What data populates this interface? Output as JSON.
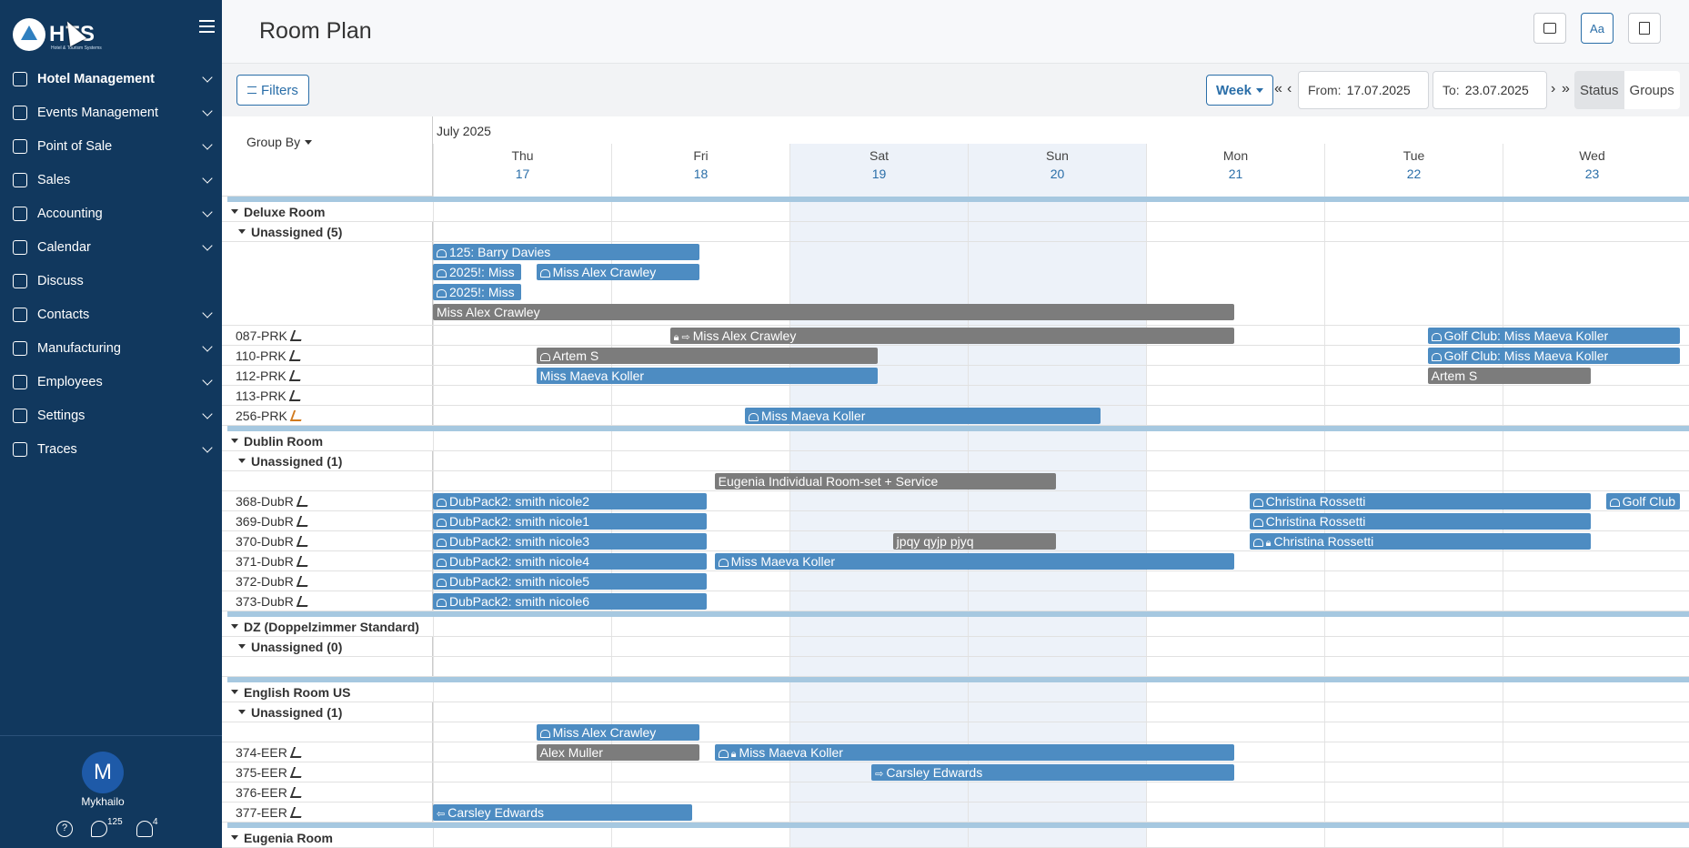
{
  "app": {
    "logo": "HTS",
    "logo_sub": "Hotel & Tourism Systems"
  },
  "sidebar": {
    "items": [
      {
        "label": "Hotel Management",
        "chevron": true,
        "active": true,
        "icon": "hotel-icon"
      },
      {
        "label": "Events Management",
        "chevron": true,
        "icon": "events-icon"
      },
      {
        "label": "Point of Sale",
        "chevron": true,
        "icon": "pos-icon"
      },
      {
        "label": "Sales",
        "chevron": true,
        "icon": "sales-icon"
      },
      {
        "label": "Accounting",
        "chevron": true,
        "icon": "accounting-icon"
      },
      {
        "label": "Calendar",
        "chevron": true,
        "icon": "calendar-icon"
      },
      {
        "label": "Discuss",
        "chevron": false,
        "icon": "discuss-icon"
      },
      {
        "label": "Contacts",
        "chevron": true,
        "icon": "contacts-icon"
      },
      {
        "label": "Manufacturing",
        "chevron": true,
        "icon": "manufacturing-icon"
      },
      {
        "label": "Employees",
        "chevron": true,
        "icon": "employees-icon"
      },
      {
        "label": "Settings",
        "chevron": true,
        "icon": "settings-icon"
      },
      {
        "label": "Traces",
        "chevron": true,
        "icon": "traces-icon"
      }
    ],
    "user": {
      "initial": "M",
      "name": "Mykhailo"
    },
    "footer": {
      "messages_count": "125",
      "notifications_count": "4"
    }
  },
  "header": {
    "title": "Room Plan",
    "font_btn": "Aa"
  },
  "toolbar": {
    "filters": "Filters",
    "view": "Week",
    "nav": {
      "first": "«",
      "prev": "‹",
      "next": "›",
      "last": "»"
    },
    "from_label": "From:",
    "from_value": "17.07.2025",
    "to_label": "To:",
    "to_value": "23.07.2025",
    "status": "Status",
    "groups": "Groups"
  },
  "grid": {
    "group_by": "Group By",
    "month": "July 2025",
    "days": [
      {
        "name": "Thu",
        "date": "17"
      },
      {
        "name": "Fri",
        "date": "18"
      },
      {
        "name": "Sat",
        "date": "19"
      },
      {
        "name": "Sun",
        "date": "20"
      },
      {
        "name": "Mon",
        "date": "21"
      },
      {
        "name": "Tue",
        "date": "22"
      },
      {
        "name": "Wed",
        "date": "23"
      }
    ],
    "rows": [
      {
        "type": "group",
        "label": "Deluxe Room"
      },
      {
        "type": "unassigned",
        "label": "Unassigned (5)"
      },
      {
        "type": "blank",
        "lines": 4,
        "bookings": [
          {
            "line": 0,
            "start": 0,
            "end": 1.5,
            "color": "blue",
            "icon": "guest",
            "text": "125: Barry Davies"
          },
          {
            "line": 1,
            "start": 0,
            "end": 0.5,
            "color": "blue",
            "icon": "guest",
            "text": "2025!: Miss"
          },
          {
            "line": 1,
            "start": 0.58,
            "end": 1.5,
            "color": "blue",
            "icon": "guest",
            "text": "Miss Alex Crawley"
          },
          {
            "line": 2,
            "start": 0,
            "end": 0.5,
            "color": "blue",
            "icon": "guest",
            "text": "2025!: Miss"
          },
          {
            "line": 3,
            "start": 0,
            "end": 4.5,
            "color": "gray",
            "icon": "",
            "text": "Miss Alex Crawley"
          }
        ]
      },
      {
        "type": "room",
        "label": "087-PRK",
        "bookings": [
          {
            "start": 1.33,
            "end": 4.5,
            "color": "gray",
            "icon": "lock-arrow",
            "text": "Miss Alex Crawley"
          },
          {
            "start": 5.58,
            "end": 7.0,
            "color": "blue",
            "icon": "guest",
            "text": "Golf Club: Miss Maeva Koller"
          }
        ]
      },
      {
        "type": "room",
        "label": "110-PRK",
        "bookings": [
          {
            "start": 0.58,
            "end": 2.5,
            "color": "gray",
            "icon": "guest",
            "text": "Artem S"
          },
          {
            "start": 5.58,
            "end": 7.0,
            "color": "blue",
            "icon": "guest",
            "text": "Golf Club: Miss Maeva Koller"
          }
        ]
      },
      {
        "type": "room",
        "label": "112-PRK",
        "bookings": [
          {
            "start": 0.58,
            "end": 2.5,
            "color": "blue",
            "icon": "",
            "text": "Miss Maeva Koller"
          },
          {
            "start": 5.58,
            "end": 6.5,
            "color": "gray",
            "icon": "",
            "text": "Artem S"
          }
        ]
      },
      {
        "type": "room",
        "label": "113-PRK",
        "bookings": []
      },
      {
        "type": "room",
        "label": "256-PRK",
        "orange": true,
        "bookings": [
          {
            "start": 1.75,
            "end": 3.75,
            "color": "blue",
            "icon": "guest",
            "text": "Miss Maeva Koller"
          }
        ]
      },
      {
        "type": "group",
        "label": "Dublin Room"
      },
      {
        "type": "unassigned",
        "label": "Unassigned (1)"
      },
      {
        "type": "blank",
        "lines": 1,
        "bookings": [
          {
            "line": 0,
            "start": 1.58,
            "end": 3.5,
            "color": "gray",
            "icon": "",
            "text": "Eugenia Individual Room-set + Service"
          }
        ]
      },
      {
        "type": "room",
        "label": "368-DubR",
        "bookings": [
          {
            "start": 0,
            "end": 1.54,
            "color": "blue",
            "icon": "guest",
            "text": "DubPack2: smith nicole2"
          },
          {
            "start": 4.58,
            "end": 6.5,
            "color": "blue",
            "icon": "guest",
            "text": "Christina Rossetti"
          },
          {
            "start": 6.58,
            "end": 7.0,
            "color": "blue",
            "icon": "guest",
            "text": "Golf Club"
          }
        ]
      },
      {
        "type": "room",
        "label": "369-DubR",
        "bookings": [
          {
            "start": 0,
            "end": 1.54,
            "color": "blue",
            "icon": "guest",
            "text": "DubPack2: smith nicole1"
          },
          {
            "start": 4.58,
            "end": 6.5,
            "color": "blue",
            "icon": "guest",
            "text": "Christina Rossetti"
          }
        ]
      },
      {
        "type": "room",
        "label": "370-DubR",
        "bookings": [
          {
            "start": 0,
            "end": 1.54,
            "color": "blue",
            "icon": "guest",
            "text": "DubPack2: smith nicole3"
          },
          {
            "start": 2.58,
            "end": 3.5,
            "color": "gray",
            "icon": "",
            "text": "jpqy qyjp pjyq"
          },
          {
            "start": 4.58,
            "end": 6.5,
            "color": "blue",
            "icon": "guest-lock",
            "text": "Christina Rossetti"
          }
        ]
      },
      {
        "type": "room",
        "label": "371-DubR",
        "bookings": [
          {
            "start": 0,
            "end": 1.54,
            "color": "blue",
            "icon": "guest",
            "text": "DubPack2: smith nicole4"
          },
          {
            "start": 1.58,
            "end": 4.5,
            "color": "blue",
            "icon": "guest",
            "text": "Miss Maeva Koller"
          }
        ]
      },
      {
        "type": "room",
        "label": "372-DubR",
        "bookings": [
          {
            "start": 0,
            "end": 1.54,
            "color": "blue",
            "icon": "guest",
            "text": "DubPack2: smith nicole5"
          }
        ]
      },
      {
        "type": "room",
        "label": "373-DubR",
        "bookings": [
          {
            "start": 0,
            "end": 1.54,
            "color": "blue",
            "icon": "guest",
            "text": "DubPack2: smith nicole6"
          }
        ]
      },
      {
        "type": "group",
        "label": "DZ (Doppelzimmer Standard)"
      },
      {
        "type": "unassigned",
        "label": "Unassigned (0)"
      },
      {
        "type": "blank",
        "lines": 1,
        "bookings": []
      },
      {
        "type": "group",
        "label": "English Room US"
      },
      {
        "type": "unassigned",
        "label": "Unassigned (1)"
      },
      {
        "type": "blank",
        "lines": 1,
        "bookings": [
          {
            "line": 0,
            "start": 0.58,
            "end": 1.5,
            "color": "blue",
            "icon": "guest",
            "text": "Miss Alex Crawley"
          }
        ]
      },
      {
        "type": "room",
        "label": "374-EER",
        "bookings": [
          {
            "start": 0.58,
            "end": 1.5,
            "color": "gray",
            "icon": "",
            "text": "Alex Muller"
          },
          {
            "start": 1.58,
            "end": 4.5,
            "color": "blue",
            "icon": "guest-lock",
            "text": "Miss Maeva Koller"
          }
        ]
      },
      {
        "type": "room",
        "label": "375-EER",
        "bookings": [
          {
            "start": 2.46,
            "end": 4.5,
            "color": "blue",
            "icon": "arrow-in",
            "text": "Carsley Edwards"
          }
        ]
      },
      {
        "type": "room",
        "label": "376-EER",
        "bookings": []
      },
      {
        "type": "room",
        "label": "377-EER",
        "bookings": [
          {
            "start": 0,
            "end": 1.46,
            "color": "blue",
            "icon": "arrow-out",
            "text": "Carsley Edwards"
          }
        ]
      },
      {
        "type": "group",
        "label": "Eugenia Room"
      }
    ]
  }
}
